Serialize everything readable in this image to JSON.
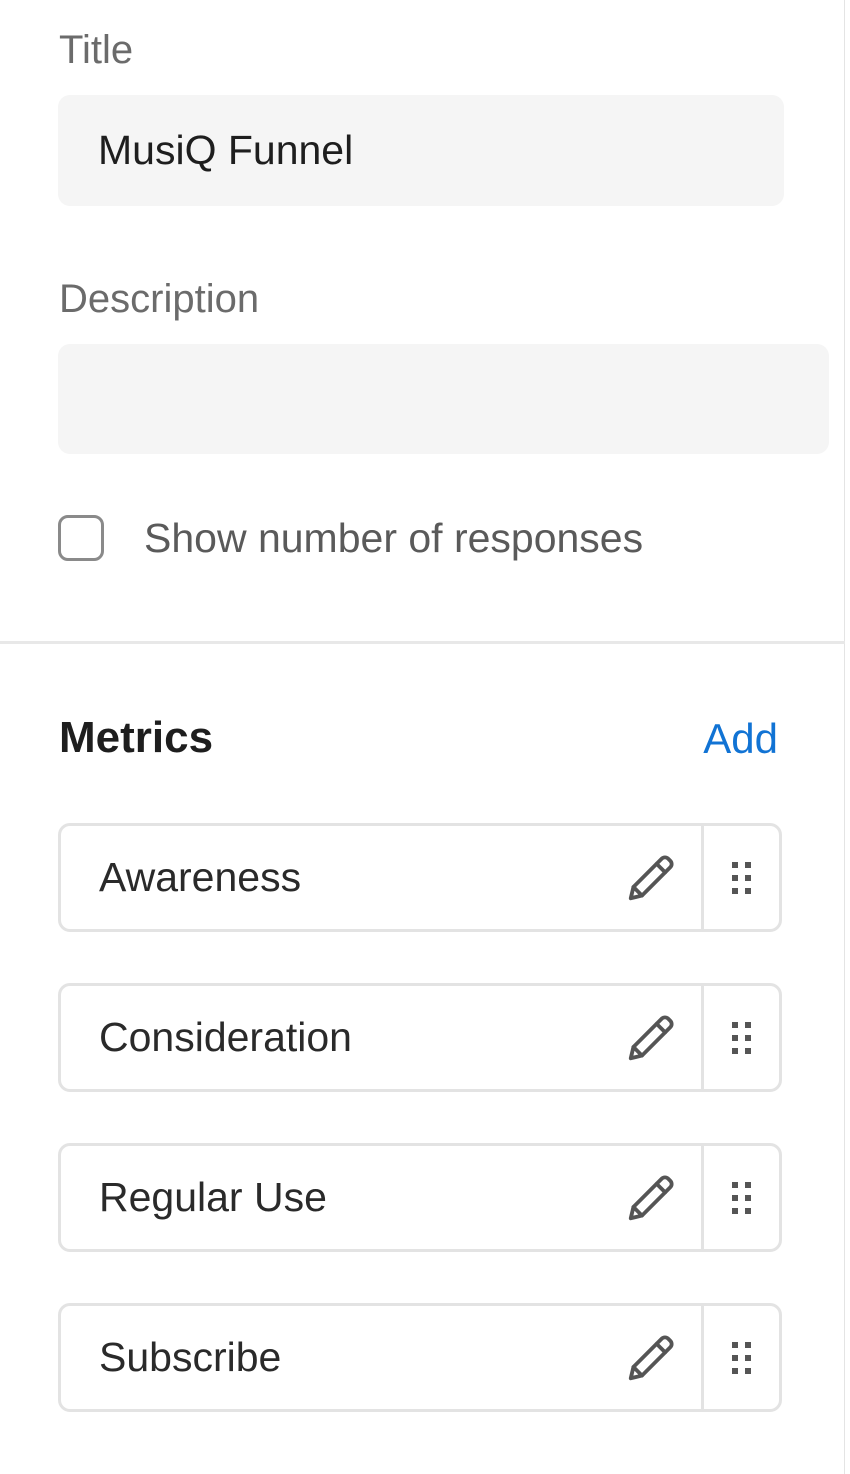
{
  "form": {
    "title_label": "Title",
    "title_value": "MusiQ Funnel",
    "description_label": "Description",
    "description_value": "",
    "show_responses_label": "Show number of responses",
    "show_responses_checked": false
  },
  "metrics": {
    "heading": "Metrics",
    "add_label": "Add",
    "items": [
      {
        "label": "Awareness",
        "edit_icon": "pencil-icon",
        "drag_icon": "drag-handle-icon"
      },
      {
        "label": "Consideration",
        "edit_icon": "pencil-icon",
        "drag_icon": "drag-handle-icon"
      },
      {
        "label": "Regular Use",
        "edit_icon": "pencil-icon",
        "drag_icon": "drag-handle-icon"
      },
      {
        "label": "Subscribe",
        "edit_icon": "pencil-icon",
        "drag_icon": "drag-handle-icon"
      }
    ]
  },
  "colors": {
    "accent": "#1173d4",
    "input_background": "#f5f5f5",
    "border": "#e3e3e3"
  }
}
